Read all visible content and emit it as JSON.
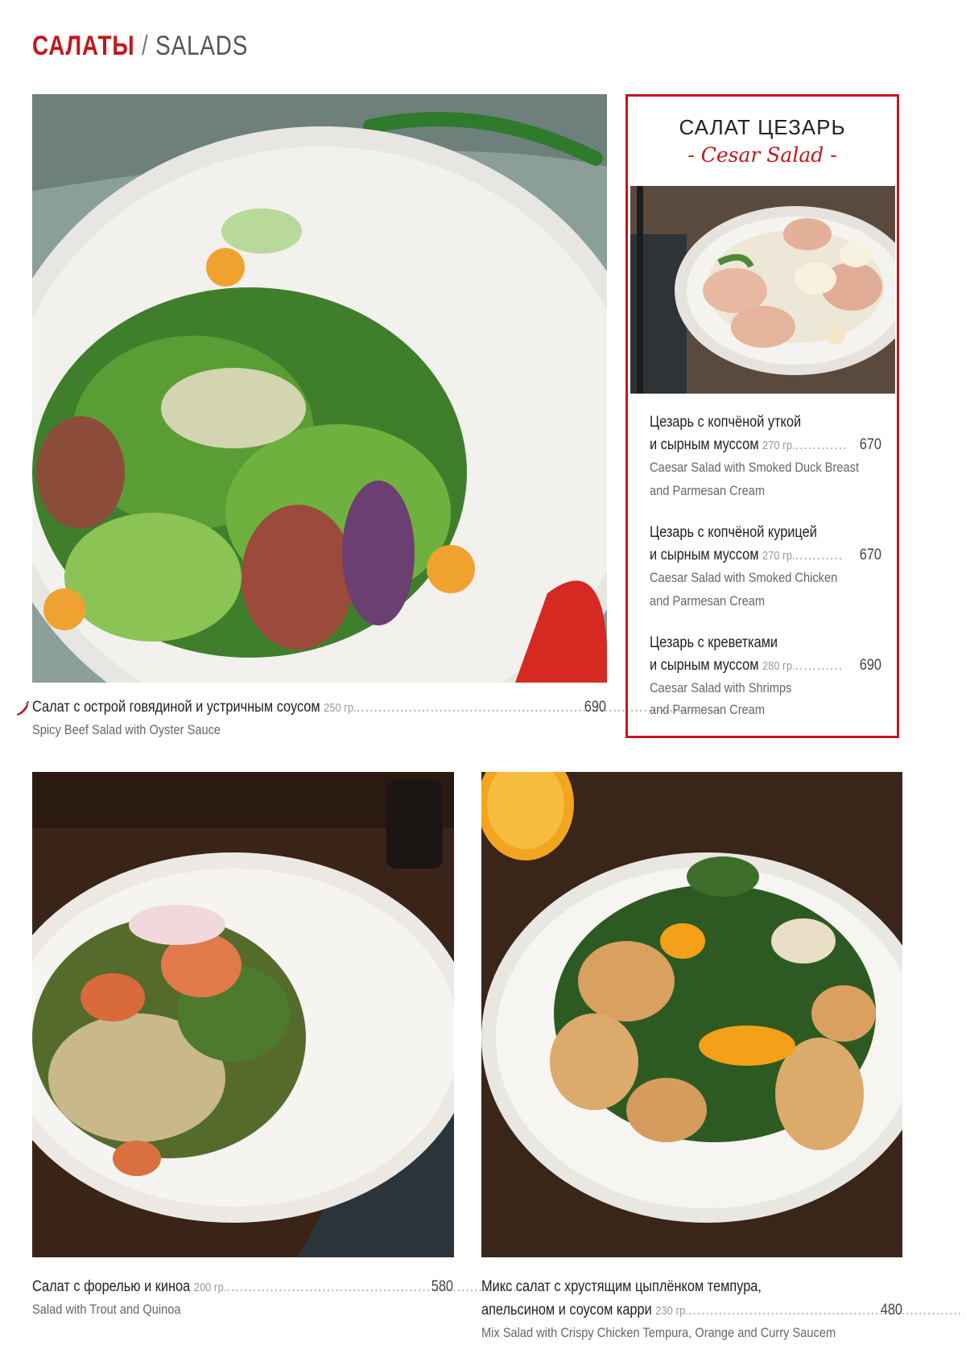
{
  "header": {
    "title_ru": "САЛАТЫ",
    "separator": "/",
    "title_en": "SALADS"
  },
  "items": [
    {
      "name_ru": "Салат с острой говядиной и устричным соусом",
      "weight": "250 гр.",
      "price": "690",
      "name_en": "Spicy Beef Salad with Oyster Sauce",
      "spicy_icon": "chili-pepper-icon"
    },
    {
      "name_ru": "Салат с форелью и киноа",
      "weight": "200 гр.",
      "price": "580",
      "name_en": "Salad with Trout and Quinoa"
    },
    {
      "name_ru_line1": "Микс салат с хрустящим цыплёнком темпура,",
      "name_ru_line2": "апельсином и соусом карри",
      "weight": "230 гр.",
      "price": "480",
      "name_en": "Mix Salad with Crispy Chicken Tempura, Orange and Curry Saucem"
    }
  ],
  "caesar": {
    "title_ru": "САЛАТ ЦЕЗАРЬ",
    "title_en": "- Cesar Salad -",
    "items": [
      {
        "ru_line1": "Цезарь с копчёной уткой",
        "ru_line2": "и сырным муссом",
        "weight": "270 гр.",
        "price": "670",
        "en_line1": "Caesar Salad with Smoked Duck Breast",
        "en_line2": "and Parmesan Cream"
      },
      {
        "ru_line1": "Цезарь с копчёной курицей",
        "ru_line2": "и сырным муссом",
        "weight": "270 гр.",
        "price": "670",
        "en_line1": "Caesar Salad with Smoked Chicken",
        "en_line2": "and Parmesan Cream"
      },
      {
        "ru_line1": "Цезарь с креветками",
        "ru_line2": "и сырным муссом",
        "weight": "280 гр.",
        "price": "690",
        "en_line1": "Caesar Salad with Shrimps",
        "en_line2": "and Parmesan Cream"
      }
    ]
  },
  "colors": {
    "accent": "#c4161c",
    "text": "#1f1f1f",
    "muted": "#666666"
  }
}
